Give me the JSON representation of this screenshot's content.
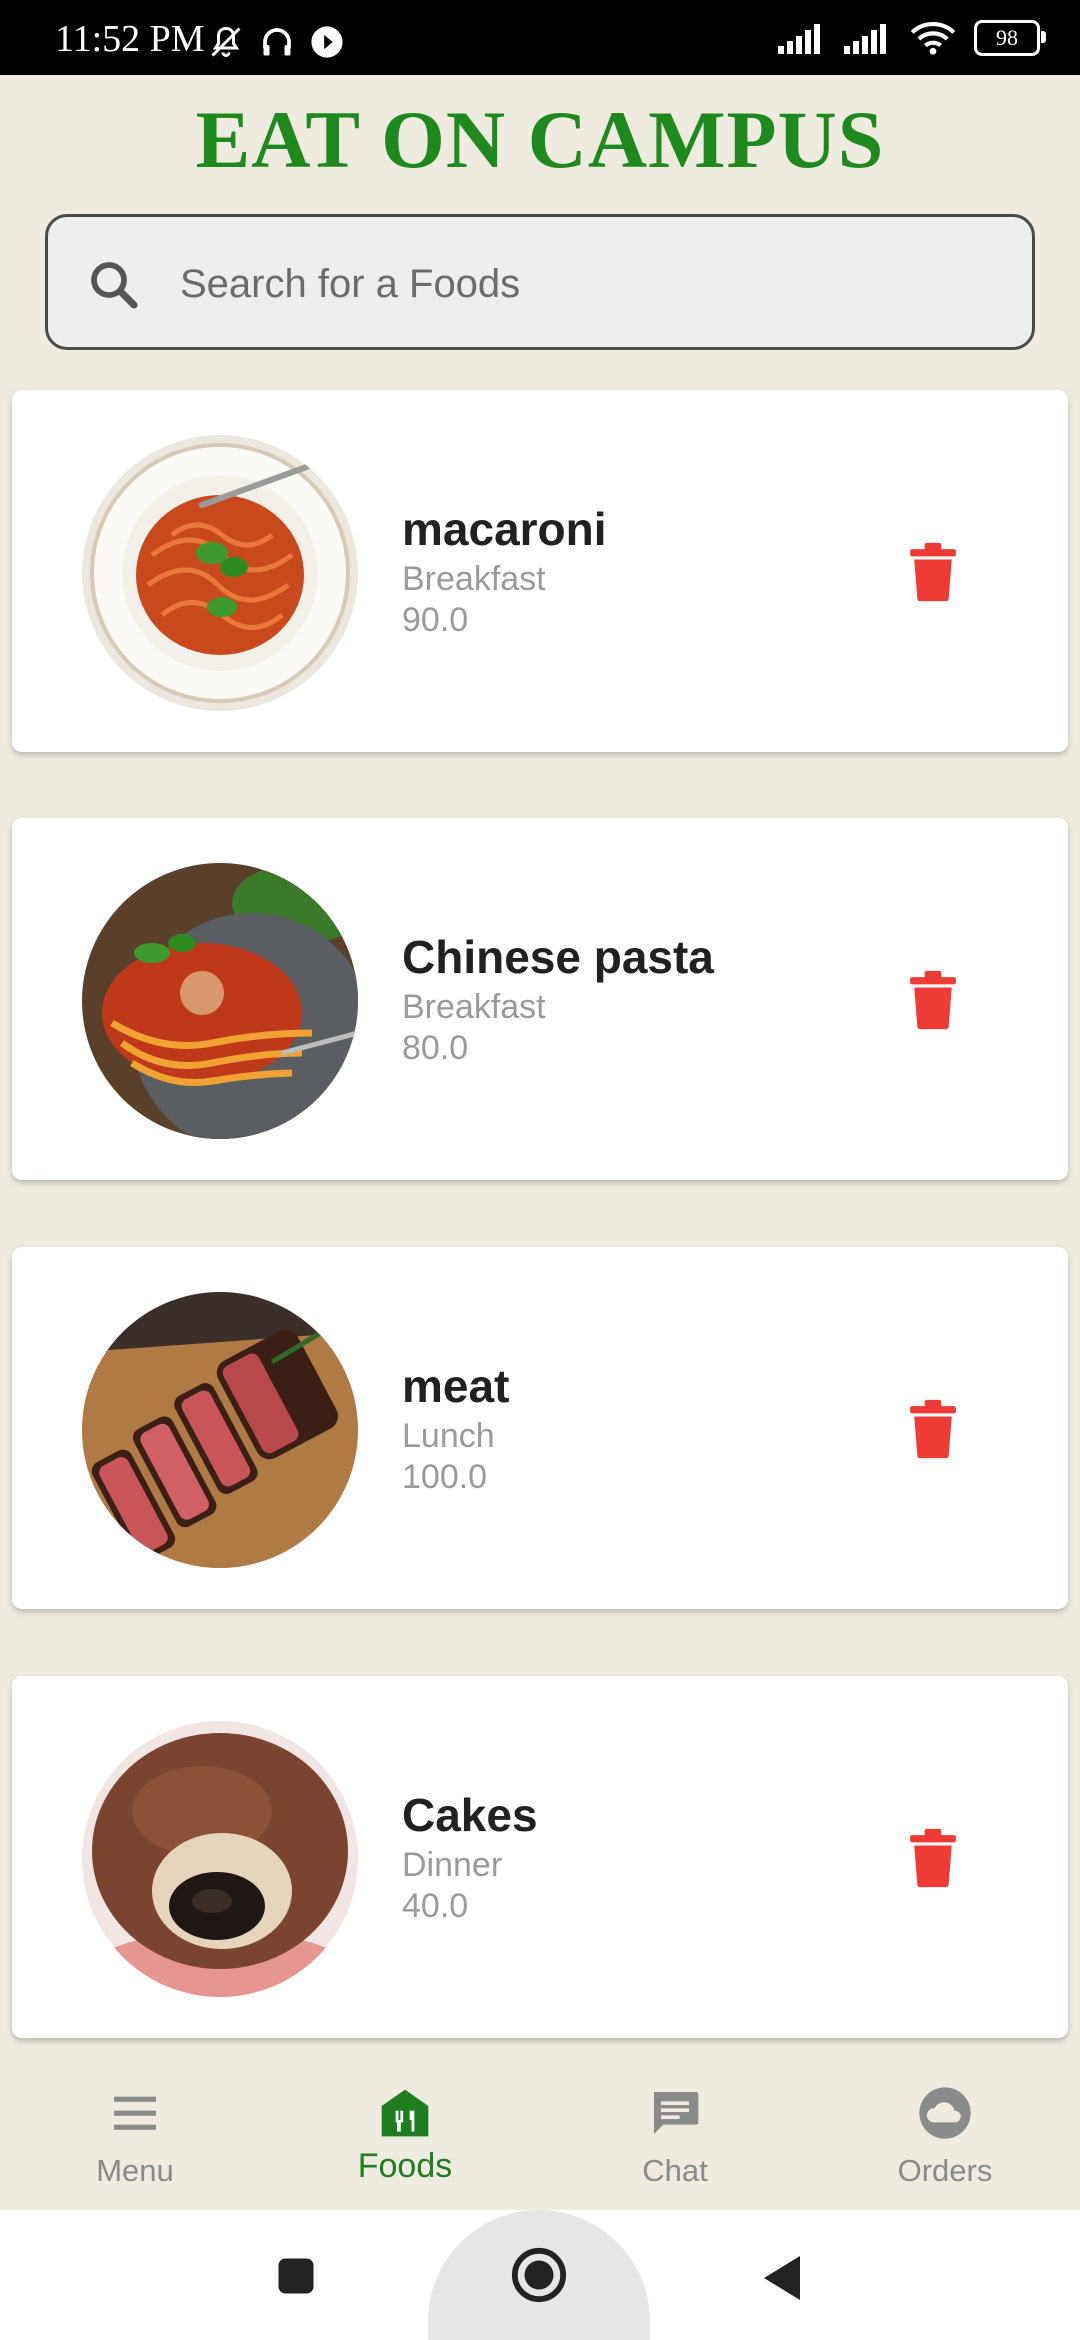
{
  "status_bar": {
    "time": "11:52 PM",
    "battery": "98"
  },
  "header": {
    "title": "EAT ON CAMPUS"
  },
  "search": {
    "placeholder": "Search for a Foods",
    "value": ""
  },
  "foods": [
    {
      "name": "macaroni",
      "category": "Breakfast",
      "price": "90.0"
    },
    {
      "name": "Chinese pasta",
      "category": "Breakfast",
      "price": "80.0"
    },
    {
      "name": "meat",
      "category": "Lunch",
      "price": "100.0"
    },
    {
      "name": "Cakes",
      "category": "Dinner",
      "price": "40.0"
    }
  ],
  "bottom_nav": {
    "items": [
      {
        "label": "Menu",
        "icon": "menu-icon"
      },
      {
        "label": "Foods",
        "icon": "store-icon",
        "active": true
      },
      {
        "label": "Chat",
        "icon": "chat-icon"
      },
      {
        "label": "Orders",
        "icon": "cloud-icon"
      }
    ]
  },
  "colors": {
    "accent": "#1e8a1e",
    "delete": "#ef3b36",
    "background": "#efebe1"
  }
}
